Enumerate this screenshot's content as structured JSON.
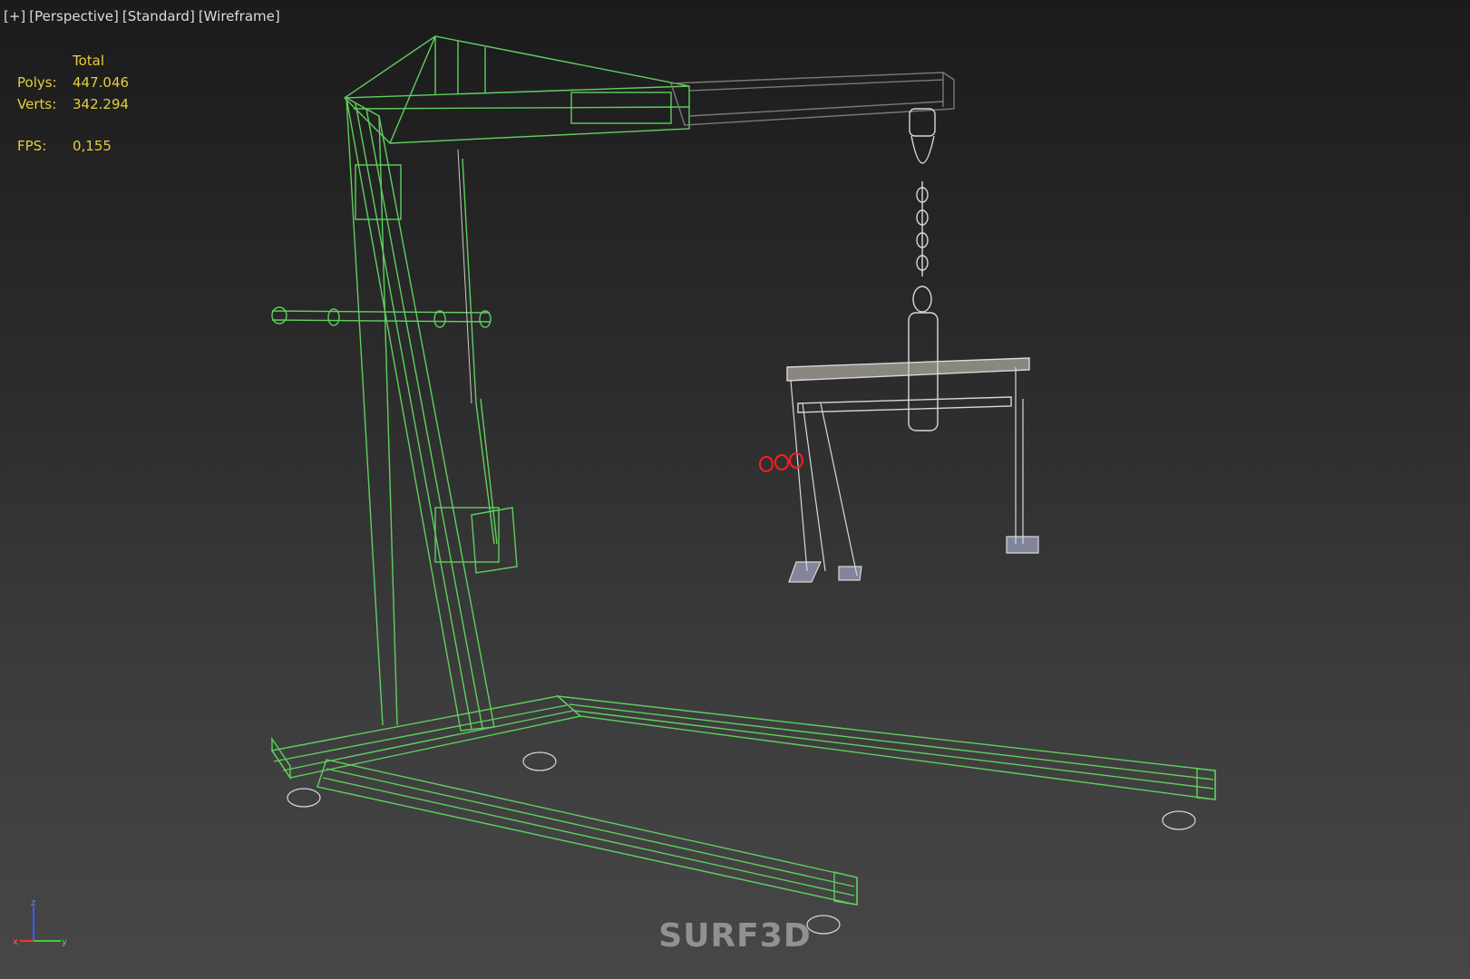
{
  "viewport_labels": {
    "plus": "[+]",
    "view": "[Perspective]",
    "shading": "[Standard]",
    "mode": "[Wireframe]"
  },
  "stats": {
    "header": "Total",
    "polys_label": "Polys:",
    "polys_value": "447.046",
    "verts_label": "Verts:",
    "verts_value": "342.294",
    "fps_label": "FPS:",
    "fps_value": "0,155"
  },
  "axis": {
    "z": "z",
    "x": "x",
    "y": "y"
  },
  "watermark": "SURF3D",
  "colors": {
    "crane_wire": "#5fcf5f",
    "boom_wire": "#7a7a7a",
    "chain_wire": "#d8d8d8",
    "selected_wire": "#ff1e1e",
    "stats_text": "#e4cf3c",
    "label_text": "#dcdcdc"
  }
}
